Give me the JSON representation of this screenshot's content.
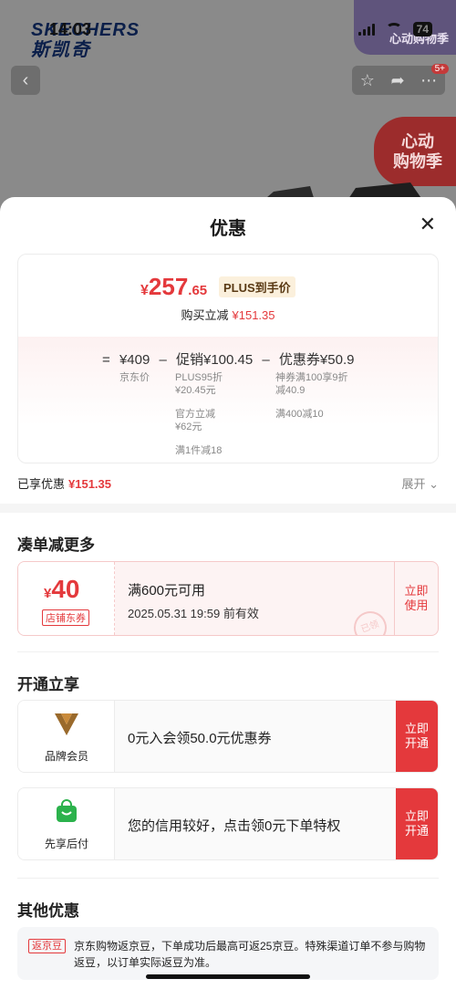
{
  "status_bar": {
    "time": "14:03",
    "battery": "74"
  },
  "brand": {
    "en": "SKECHERS",
    "cn": "斯凯奇"
  },
  "promo_banner": {
    "text": "心动购物季"
  },
  "header": {
    "badge": "5+"
  },
  "heart_badge": {
    "line1": "心动",
    "line2": "购物季"
  },
  "sheet": {
    "title": "优惠"
  },
  "price": {
    "currency": "¥",
    "integer": "257",
    "decimal": ".65",
    "plus_tag": "PLUS到手价",
    "save_label": "购买立减",
    "save_amount": "¥151.35"
  },
  "formula": {
    "eq": "=",
    "base": "¥409",
    "minus1": "–",
    "promo": "促销¥100.45",
    "minus2": "–",
    "coupon": "优惠券¥50.9",
    "base_label": "京东价",
    "promo_items": [
      "PLUS95折\n¥20.45元",
      "官方立减\n¥62元",
      "满1件减18"
    ],
    "coupon_items": [
      "神券满100享9折\n减40.9",
      "满400减10"
    ]
  },
  "enjoyed": {
    "label": "已享优惠",
    "amount": "¥151.35",
    "expand": "展开"
  },
  "section_more": {
    "title": "凑单减更多"
  },
  "coupon": {
    "currency": "¥",
    "amount": "40",
    "type": "店铺东券",
    "condition": "满600元可用",
    "expiry": "2025.05.31 19:59 前有效",
    "use_btn": "立即\n使用",
    "stamp": "已领"
  },
  "section_open": {
    "title": "开通立享"
  },
  "offers": [
    {
      "label": "品牌会员",
      "text": "0元入会领50.0元优惠券",
      "btn": "立即\n开通"
    },
    {
      "label": "先享后付",
      "text": "您的信用较好，点击领0元下单特权",
      "btn": "立即\n开通"
    }
  ],
  "section_other": {
    "title": "其他优惠"
  },
  "other": {
    "tag": "返京豆",
    "text": "京东购物返京豆，下单成功后最高可返25京豆。特殊渠道订单不参与购物返豆，以订单实际返豆为准。"
  },
  "colors": {
    "accent": "#e4393c",
    "plus_bg": "#fbf0dc"
  }
}
